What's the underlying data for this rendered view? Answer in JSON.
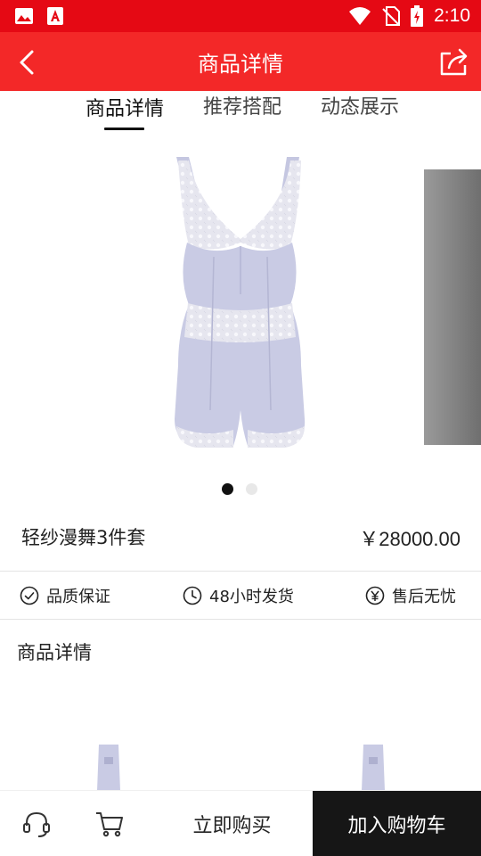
{
  "status_bar": {
    "time": "2:10",
    "icons": [
      "gallery-icon",
      "app-notification-icon",
      "wifi-icon",
      "no-sim-icon",
      "battery-charging-icon"
    ]
  },
  "header": {
    "title": "商品详情",
    "back_icon": "chevron-left-icon",
    "share_icon": "share-icon"
  },
  "tabs": [
    {
      "label": "商品详情",
      "active": true
    },
    {
      "label": "推荐搭配",
      "active": false
    },
    {
      "label": "动态展示",
      "active": false
    }
  ],
  "gallery": {
    "image": "lavender lace bodysuit shapewear",
    "slide_count": 2,
    "active_index": 0
  },
  "product": {
    "name": "轻纱漫舞3件套",
    "price": "￥28000.00"
  },
  "badges": [
    {
      "icon": "check-circle-icon",
      "label": "品质保证"
    },
    {
      "icon": "clock-icon",
      "label": "48小时发货"
    },
    {
      "icon": "yen-circle-icon",
      "label": "售后无忧"
    }
  ],
  "details": {
    "title": "商品详情"
  },
  "bottom_bar": {
    "service_icon": "headset-icon",
    "cart_icon": "cart-icon",
    "buy_now": "立即购买",
    "add_to_cart": "加入购物车"
  },
  "colors": {
    "status_bar": "#e50914",
    "app_bar": "#f32828",
    "add_cart_bg": "#161616",
    "garment": "#c9cbe4"
  }
}
